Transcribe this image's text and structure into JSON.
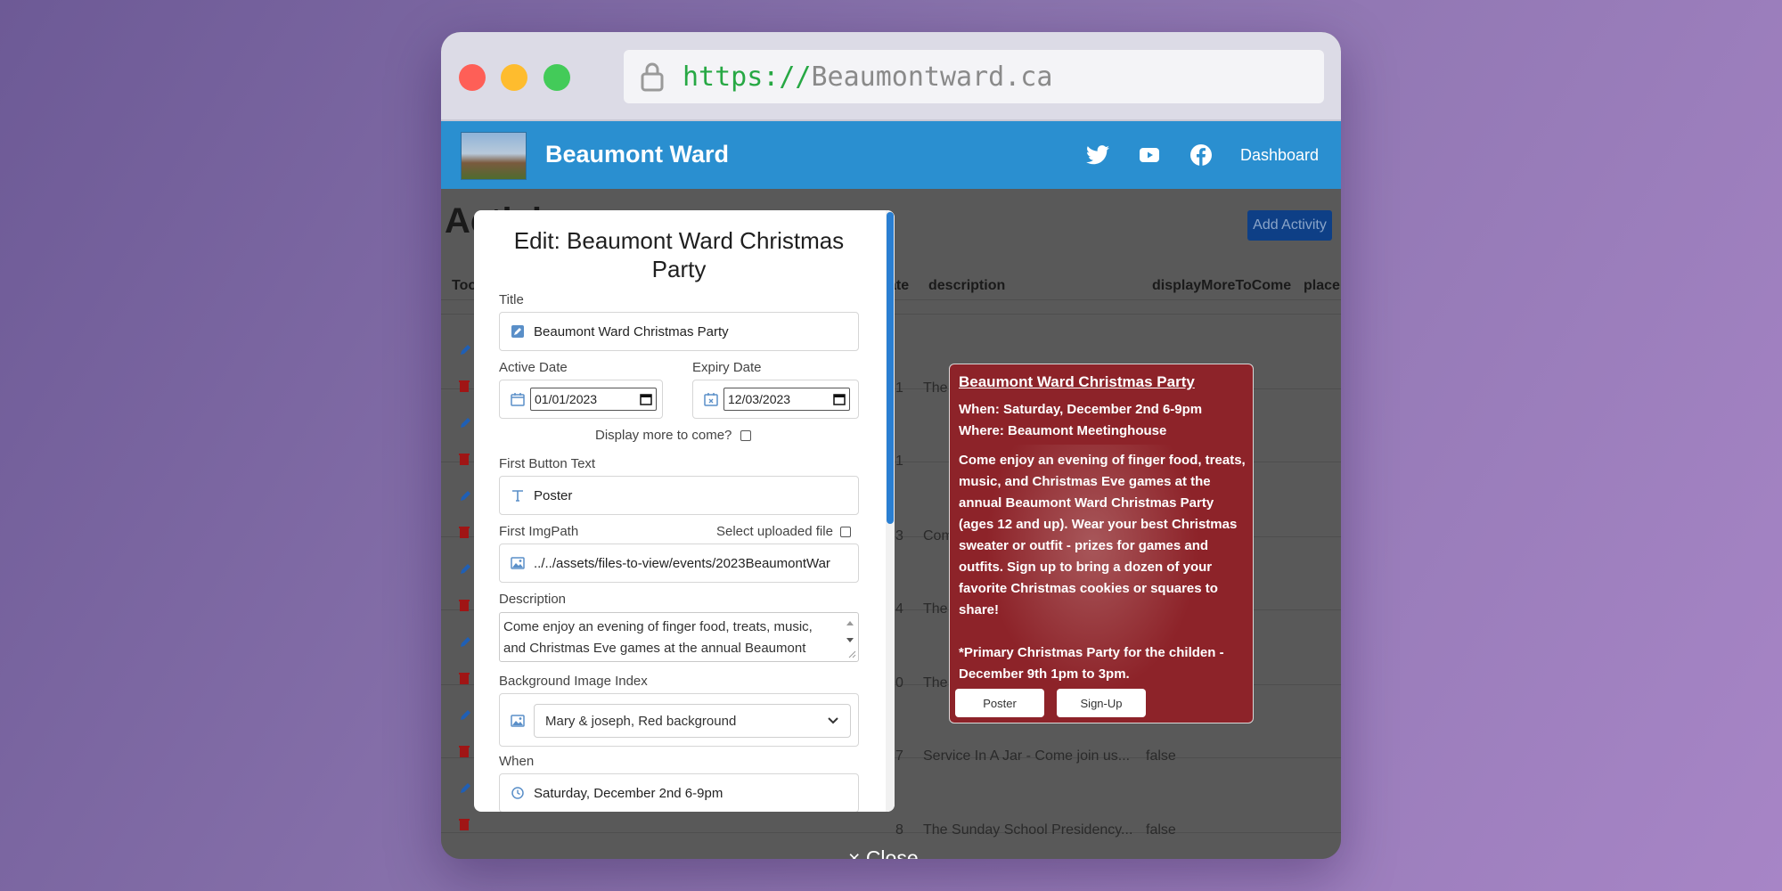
{
  "browser": {
    "url_scheme": "https://",
    "url_host": "Beaumontward.ca"
  },
  "navbar": {
    "site_name": "Beaumont Ward",
    "dashboard_label": "Dashboard",
    "icons": [
      "twitter-icon",
      "youtube-icon",
      "facebook-icon"
    ]
  },
  "page": {
    "title": "Activi",
    "add_button": "Add Activity",
    "columns": {
      "tools": "Too",
      "date": "ate",
      "description": "description",
      "display_more": "displayMoreToCome",
      "place": "place"
    },
    "rows": [
      {
        "num": "1",
        "description": "The",
        "display_more": ""
      },
      {
        "num": "1",
        "description": "",
        "display_more": ""
      },
      {
        "num": "3",
        "description": "Com",
        "display_more": ""
      },
      {
        "num": "4",
        "description": "The",
        "display_more": ""
      },
      {
        "num": "0",
        "description": "The",
        "display_more": ""
      },
      {
        "num": "7",
        "description": "Service In A Jar - Come join us...",
        "display_more": "false"
      },
      {
        "num": "8",
        "description": "The Sunday School Presidency...",
        "display_more": "false"
      }
    ]
  },
  "modal": {
    "title": "Edit: Beaumont Ward Christmas Party",
    "title_label": "Title",
    "title_value": "Beaumont Ward Christmas Party",
    "active_date_label": "Active Date",
    "active_date_value": "01/01/2023",
    "expiry_date_label": "Expiry Date",
    "expiry_date_value": "12/03/2023",
    "display_more_label": "Display more to come?",
    "display_more_checked": false,
    "first_button_label": "First Button Text",
    "first_button_value": "Poster",
    "first_imgpath_label": "First ImgPath",
    "select_uploaded_label": "Select uploaded file",
    "first_imgpath_value": "../../assets/files-to-view/events/2023BeaumontWar",
    "description_label": "Description",
    "description_value": "Come enjoy an evening of finger food, treats, music, and Christmas Eve games at the annual Beaumont",
    "bg_index_label": "Background Image Index",
    "bg_index_value": "Mary & joseph, Red background",
    "when_label": "When",
    "when_value": "Saturday, December 2nd 6-9pm",
    "close_label": "× Close"
  },
  "preview": {
    "title": "Beaumont Ward Christmas Party",
    "when": "When: Saturday, December 2nd 6-9pm",
    "where": "Where: Beaumont Meetinghouse",
    "description": "Come enjoy an evening of finger food, treats, music, and Christmas Eve games at the annual Beaumont Ward Christmas Party (ages 12 and up). Wear your best Christmas sweater or outfit - prizes for games and outfits. Sign up to bring a dozen of your favorite Christmas cookies or squares to share!",
    "primary_note": "*Primary Christmas Party for the childen - December 9th 1pm to 3pm.",
    "button1": "Poster",
    "button2": "Sign-Up",
    "bg_color": "#8d2329"
  },
  "colors": {
    "navbar": "#2a8fd0",
    "accent": "#2a7fd2",
    "scheme_green": "#27a844"
  }
}
